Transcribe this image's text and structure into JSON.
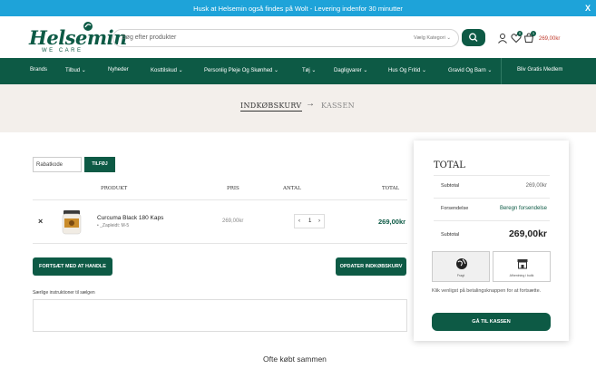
{
  "announcement": {
    "text": "Husk at Helsemin også findes på Wolt - Levering indenfor 30 minutter",
    "close": "X"
  },
  "header": {
    "logo_text": "Helsemin",
    "logo_tagline": "WE CARE",
    "search_placeholder": "Søg efter produkter",
    "category_select": "Vælg Kategori",
    "wishlist_count": "0",
    "cart_count": "1",
    "cart_amount": "269,00kr"
  },
  "nav": {
    "items": [
      {
        "label": "Brands",
        "caret": false
      },
      {
        "label": "Tilbud",
        "caret": true
      },
      {
        "label": "Nyheder",
        "caret": false
      },
      {
        "label": "Kosttilskud",
        "caret": true
      },
      {
        "label": "Personlig Pleje Og Skønhed",
        "caret": true
      },
      {
        "label": "Tøj",
        "caret": true
      },
      {
        "label": "Dagligvarer",
        "caret": true
      },
      {
        "label": "Hus Og Fritid",
        "caret": true
      },
      {
        "label": "Gravid Og Barn",
        "caret": true
      }
    ],
    "member": "Bliv Gratis Medlem"
  },
  "breadcrumb": {
    "step1": "INDKØBSKURV",
    "arrow": "→",
    "step2": "KASSEN"
  },
  "coupon": {
    "placeholder": "Rabatkode",
    "apply": "TILFØJ"
  },
  "table": {
    "headers": {
      "product": "PRODUKT",
      "price": "PRIS",
      "qty": "ANTAL",
      "total": "TOTAL"
    },
    "row": {
      "remove": "×",
      "name": "Curcuma Black 180 Kaps",
      "meta": "• _Zapleidt: M-5",
      "price": "269,00kr",
      "qty": "1",
      "minus": "‹",
      "plus": "›",
      "total": "269,00kr"
    }
  },
  "buttons": {
    "continue": "FORTSÆT MED AT HANDLE",
    "update": "OPDATER INDKØBSKURV"
  },
  "notes": {
    "label": "Særlige instruktioner til sælgen"
  },
  "often_bought": "Ofte købt sammen",
  "totals": {
    "title": "TOTAL",
    "subtotal_label": "Subtotal",
    "subtotal_value": "269,00kr",
    "shipping_label": "Forsendelse",
    "shipping_value": "Beregn forsendelse",
    "total_label": "Subtotal",
    "total_value": "269,00kr",
    "pay_options": [
      "Fragt",
      "Afhentning i butik"
    ],
    "note": "Klik venligst på betalingsknappen for at fortsætte.",
    "checkout": "GÅ TIL KASSEN"
  },
  "colors": {
    "brand_green": "#0d5a45",
    "topbar_blue": "#1ea3d9",
    "band_beige": "#f3efeb",
    "price_red": "#c0392b"
  }
}
